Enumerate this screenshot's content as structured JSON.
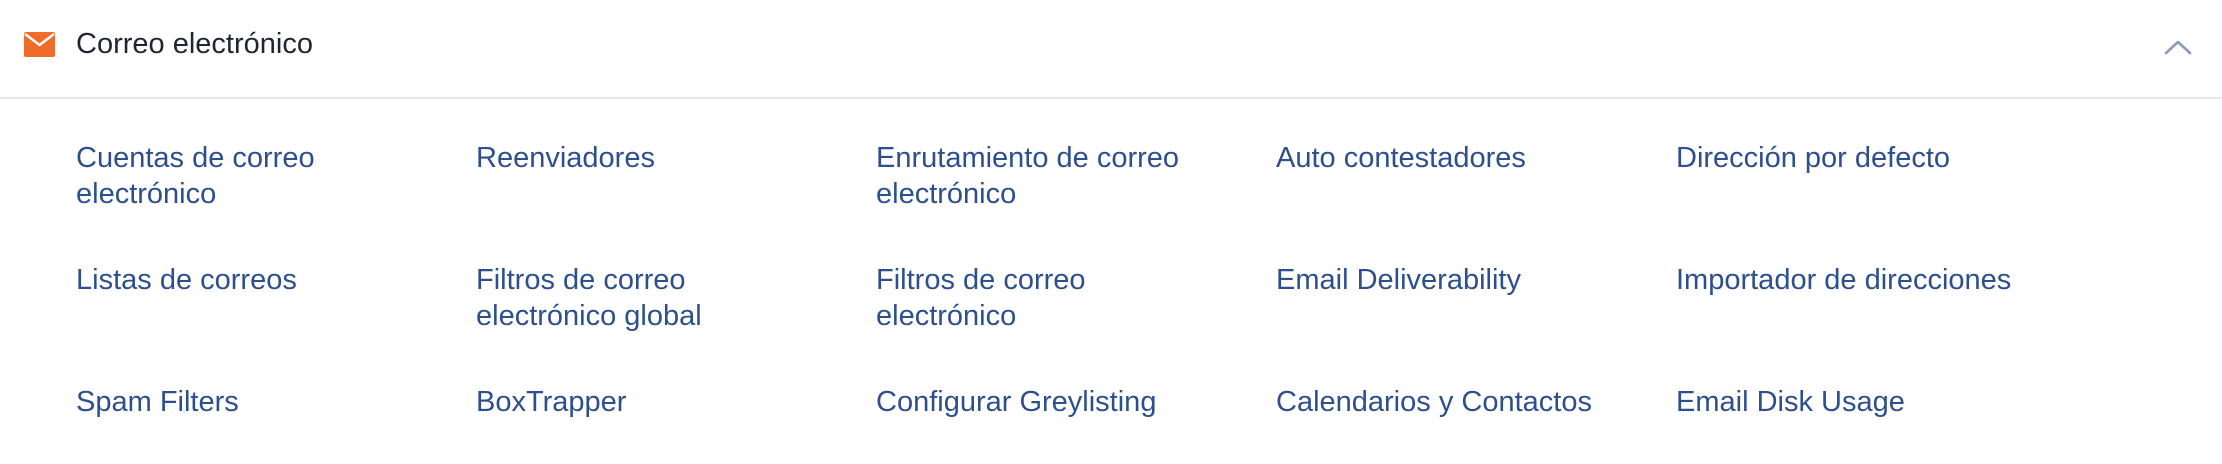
{
  "section": {
    "title": "Correo electrónico",
    "icon": "envelope-icon",
    "collapse_icon": "chevron-up-icon",
    "accent_color": "#ef6c2a",
    "link_color": "#2d4f8e"
  },
  "links": [
    {
      "id": "cuentas",
      "label": "Cuentas de correo electrónico"
    },
    {
      "id": "reenviadores",
      "label": "Reenviadores"
    },
    {
      "id": "enrutamiento",
      "label": "Enrutamiento de correo electrónico"
    },
    {
      "id": "auto-contestadores",
      "label": "Auto contestadores"
    },
    {
      "id": "direccion-defecto",
      "label": "Dirección por defecto"
    },
    {
      "id": "listas",
      "label": "Listas de correos"
    },
    {
      "id": "filtros-global",
      "label": "Filtros de correo electrónico global"
    },
    {
      "id": "filtros",
      "label": "Filtros de correo electrónico"
    },
    {
      "id": "deliverability",
      "label": "Email Deliverability"
    },
    {
      "id": "importador",
      "label": "Importador de direcciones"
    },
    {
      "id": "spam",
      "label": "Spam Filters"
    },
    {
      "id": "boxtrapper",
      "label": "BoxTrapper"
    },
    {
      "id": "greylisting",
      "label": "Configurar Greylisting"
    },
    {
      "id": "calendarios",
      "label": "Calendarios y Contactos"
    },
    {
      "id": "disk-usage",
      "label": "Email Disk Usage"
    }
  ]
}
